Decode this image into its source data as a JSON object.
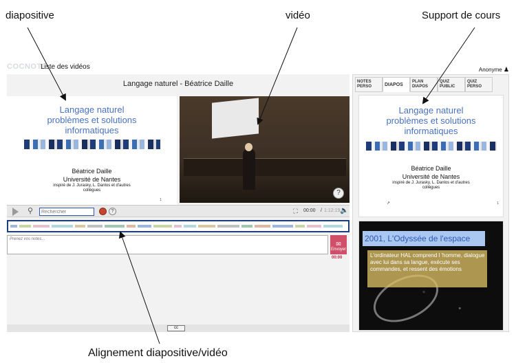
{
  "annotations": {
    "slide": "diapositive",
    "video": "vidéo",
    "support": "Support de cours",
    "alignment": "Alignement  diapositive/vidéo"
  },
  "header": {
    "logo": "COCNOTE",
    "nav_videos": "Liste des vidéos",
    "user": "Anonyme",
    "user_icon": "person-icon"
  },
  "video_title": "Langage naturel - Béatrice Daille",
  "slide": {
    "title_lines": [
      "Langage naturel",
      "problèmes et solutions",
      "informatiques"
    ],
    "author": "Béatrice Daille",
    "institution": "Université de Nantes",
    "credit_lines": [
      "inspiré de J. Jurasky, L. Danlos et d'autres",
      "collègues"
    ],
    "page": "1"
  },
  "player": {
    "search_placeholder": "Rechercher",
    "time_current": "00:00",
    "time_separator": "/",
    "time_total": "1:12:19"
  },
  "notes": {
    "placeholder": "Prenez vos notes...",
    "send_label": "Envoyer",
    "send_time": "00:00"
  },
  "footer": {
    "license": "cc"
  },
  "tabs": [
    {
      "label": "NOTES PERSO",
      "active": false
    },
    {
      "label": "DIAPOS",
      "active": true
    },
    {
      "label": "PLAN DIAPOS",
      "active": false
    },
    {
      "label": "QUIZ PUBLIC",
      "active": false
    },
    {
      "label": "QUIZ PERSO",
      "active": false
    }
  ],
  "support_slide2": {
    "title": "2001, L'Odyssée de l'espace",
    "body": "L'ordinateur HAL comprend l 'homme, dialogue avec lui dans sa langue, exécute ses commandes, et ressent des émotions"
  },
  "colors": {
    "accent": "#1a3f7a",
    "slide_title": "#4a72c0",
    "send_button": "#d0506a"
  }
}
